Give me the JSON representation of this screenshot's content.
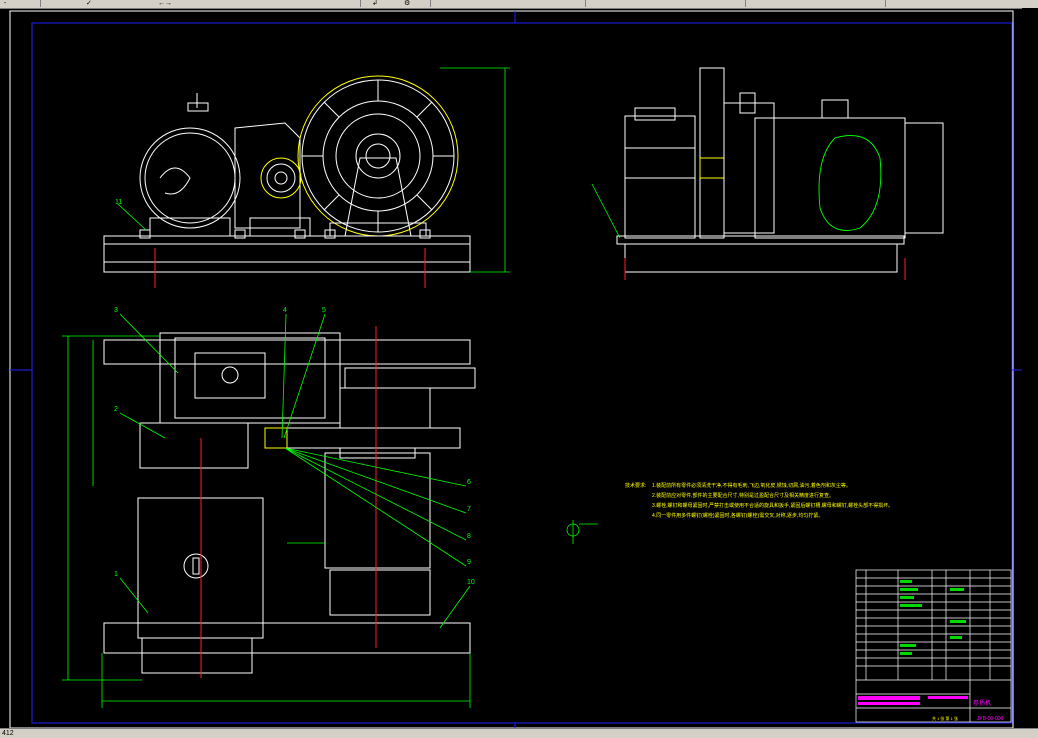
{
  "toolbar": {
    "items": [
      "-",
      "✓",
      "←→",
      "↲",
      "⚙"
    ]
  },
  "status": {
    "coord": "412"
  },
  "drawing": {
    "leaders_front": [
      "11"
    ],
    "leaders_top": [
      "3",
      "2",
      "4",
      "5",
      "1",
      "6",
      "7",
      "8",
      "9",
      "10"
    ],
    "notes_heading": "技术要求:",
    "notes": [
      "1.装配前所有零件必须清洗干净,不得有毛刺,飞边,氧化皮,锈蚀,切屑,油污,着色剂和灰尘等。",
      "2.装配前应对零件,部件的主要配合尺寸,特别是过盈配合尺寸及相关精度进行复查。",
      "3.螺栓,螺钉和螺母紧固时,严禁打击或使用不合适的旋具和扳手,紧固后螺钉槽,螺母和螺钉,螺栓头部不得损坏。",
      "4.同一零件用多件螺钉(螺栓)紧固时,各螺钉(螺栓)需交叉,对称,逐步,均匀拧紧。"
    ],
    "title_block": {
      "name": "卷扬机",
      "number": "JYB-00-000",
      "sheet": "共 1 张 第 1 张"
    }
  },
  "colors": {
    "line": "#ffffff",
    "dim": "#00ff00",
    "frame": "#2020ff",
    "center": "#ff2020",
    "highlight": "#ffff00",
    "accent": "#ff00ff"
  }
}
